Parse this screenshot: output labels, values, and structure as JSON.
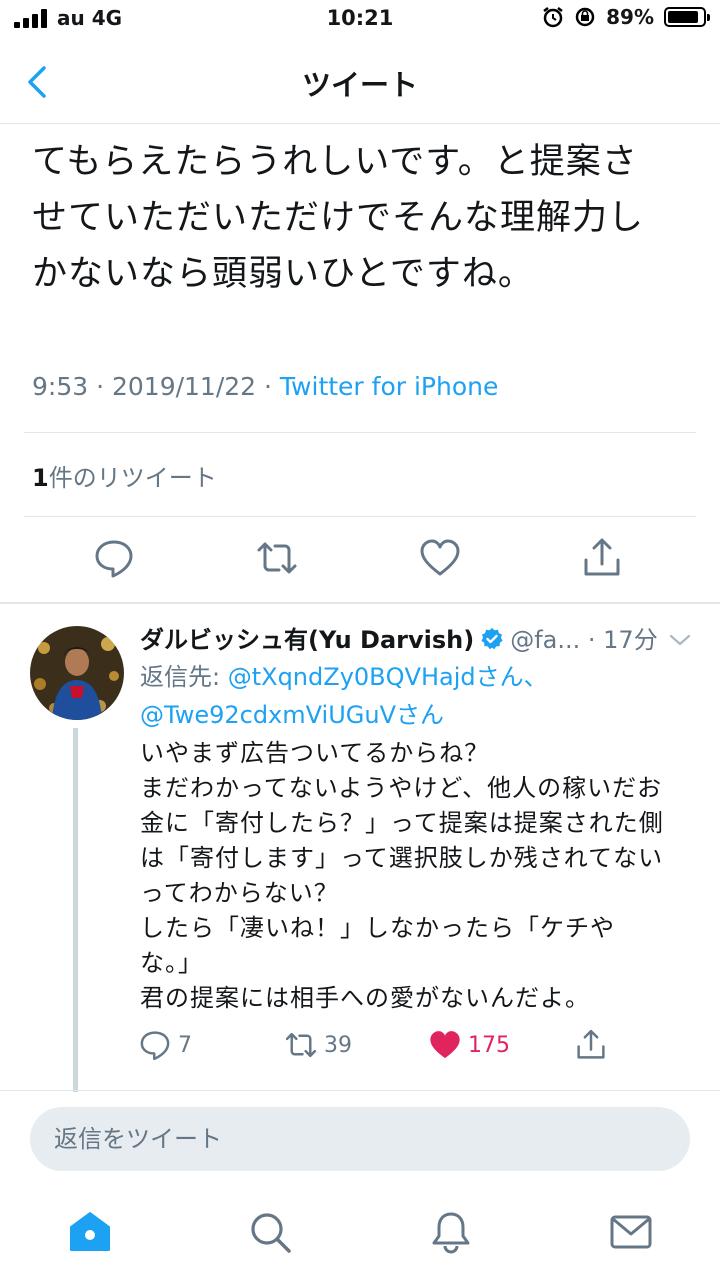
{
  "status_bar": {
    "carrier": "au 4G",
    "time": "10:21",
    "battery_percent": "89%",
    "battery_level": 0.89
  },
  "nav": {
    "title": "ツイート"
  },
  "tweet": {
    "text": "てもらえたらうれしいです。と提案さ\nせていただいただけでそんな理解力し\nかないなら頭弱いひとですね。",
    "time_date": "9:53 · 2019/11/22 · ",
    "source": "Twitter for iPhone",
    "retweet_count": "1",
    "retweet_label": "件のリツイート"
  },
  "reply": {
    "name": "ダルビッシュ有(Yu Darvish)",
    "handle": "@fa...",
    "time": " · 17分",
    "reply_to_label": "返信先: ",
    "mention1": "@tXqndZy0BQVHajd",
    "san1": "さん、",
    "mention2": "@Twe92cdxmViUGuV",
    "san2": "さん",
    "text": "いやまず広告ついてるからね？\nまだわかってないようやけど、他人の稼いだお\n金に「寄付したら？」って提案は提案された側\nは「寄付します」って選択肢しか残されてない\nってわからない？\nしたら「凄いね！」しなかったら「ケチや\nな。」\n君の提案には相手への愛がないんだよ。",
    "reply_count": "7",
    "retweet_count": "39",
    "like_count": "175"
  },
  "compose": {
    "placeholder": "返信をツイート"
  },
  "colors": {
    "accent": "#1da1f2",
    "like": "#e0245e",
    "muted": "#657786"
  }
}
